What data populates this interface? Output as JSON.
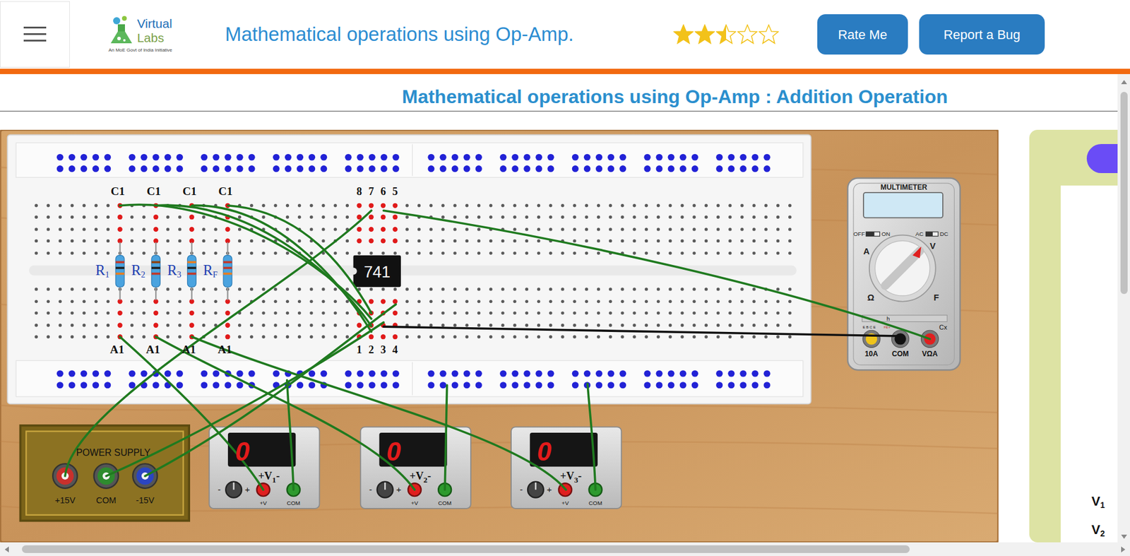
{
  "header": {
    "logo": {
      "name_top": "Virtual",
      "name_bottom": "Labs",
      "tagline": "An MoE Govt of India Initiative"
    },
    "title": "Mathematical operations using Op-Amp.",
    "rating": {
      "stars": 2.5
    },
    "buttons": [
      "Rate Me",
      "Report a Bug"
    ]
  },
  "page_title": "Mathematical operations using Op-Amp : Addition Operation",
  "breadboard": {
    "top_labels": [
      "C1",
      "C1",
      "C1",
      "C1"
    ],
    "bottom_labels": [
      "A1",
      "A1",
      "A1",
      "A1"
    ],
    "resistors": [
      {
        "label": "R",
        "sub": "1"
      },
      {
        "label": "R",
        "sub": "2"
      },
      {
        "label": "R",
        "sub": "3"
      },
      {
        "label": "R",
        "sub": "F"
      }
    ],
    "ic": {
      "label": "741",
      "top_pins": [
        "8",
        "7",
        "6",
        "5"
      ],
      "bottom_pins": [
        "1",
        "2",
        "3",
        "4"
      ]
    }
  },
  "multimeter": {
    "title": "MULTIMETER",
    "switch_left": [
      "OFF",
      "ON"
    ],
    "switch_right": [
      "AC",
      "DC"
    ],
    "dial": [
      "A",
      "V",
      "Ω",
      "F"
    ],
    "port_panel": [
      "E B C E",
      "FE+",
      "h"
    ],
    "cx": "Cx",
    "ports": [
      {
        "label": "10A",
        "color": "#f0c419"
      },
      {
        "label": "COM",
        "color": "#111111"
      },
      {
        "label": "VΩA",
        "color": "#e02020"
      }
    ]
  },
  "power_supply": {
    "title": "POWER SUPPLY",
    "terminals": [
      {
        "label": "+15V",
        "color": "#c9302c"
      },
      {
        "label": "COM",
        "color": "#2e8b2e"
      },
      {
        "label": "-15V",
        "color": "#2b45c2"
      }
    ]
  },
  "sources": [
    {
      "display": "0",
      "label": "+V",
      "sub": "1",
      "suffix": "-",
      "knob_minus": "-",
      "knob_plus": "+",
      "terminals": [
        "+V",
        "COM"
      ]
    },
    {
      "display": "0",
      "label": "+V",
      "sub": "2",
      "suffix": "-",
      "knob_minus": "-",
      "knob_plus": "+",
      "terminals": [
        "+V",
        "COM"
      ]
    },
    {
      "display": "0",
      "label": "+V",
      "sub": "3",
      "suffix": "-",
      "knob_minus": "-",
      "knob_plus": "+",
      "terminals": [
        "+V",
        "COM"
      ]
    }
  ],
  "side_panel": {
    "labels": [
      {
        "text": "V",
        "sub": "1"
      },
      {
        "text": "V",
        "sub": "2"
      }
    ]
  }
}
